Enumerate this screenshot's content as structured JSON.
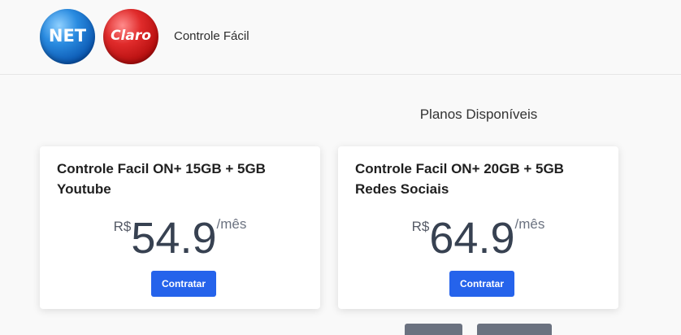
{
  "header": {
    "logos": [
      {
        "name": "net-logo",
        "text": "NET",
        "color": "#1a73d9"
      },
      {
        "name": "claro-logo",
        "text": "Claro",
        "color": "#d81f1f"
      }
    ],
    "brand_title": "Controle Fácil"
  },
  "main": {
    "section_title": "Planos Disponíveis",
    "plans": [
      {
        "name": "Controle Facil ON+ 15GB + 5GB Youtube",
        "currency": "R$",
        "price": "54.9",
        "period": "/mês",
        "button_label": "Contratar"
      },
      {
        "name": "Controle Facil ON+ 20GB + 5GB Redes Sociais",
        "currency": "R$",
        "price": "64.9",
        "period": "/mês",
        "button_label": "Contratar"
      }
    ]
  },
  "colors": {
    "accent": "#2563eb",
    "background": "#f9f9f9",
    "card": "#ffffff",
    "pager": "#6b7280"
  }
}
